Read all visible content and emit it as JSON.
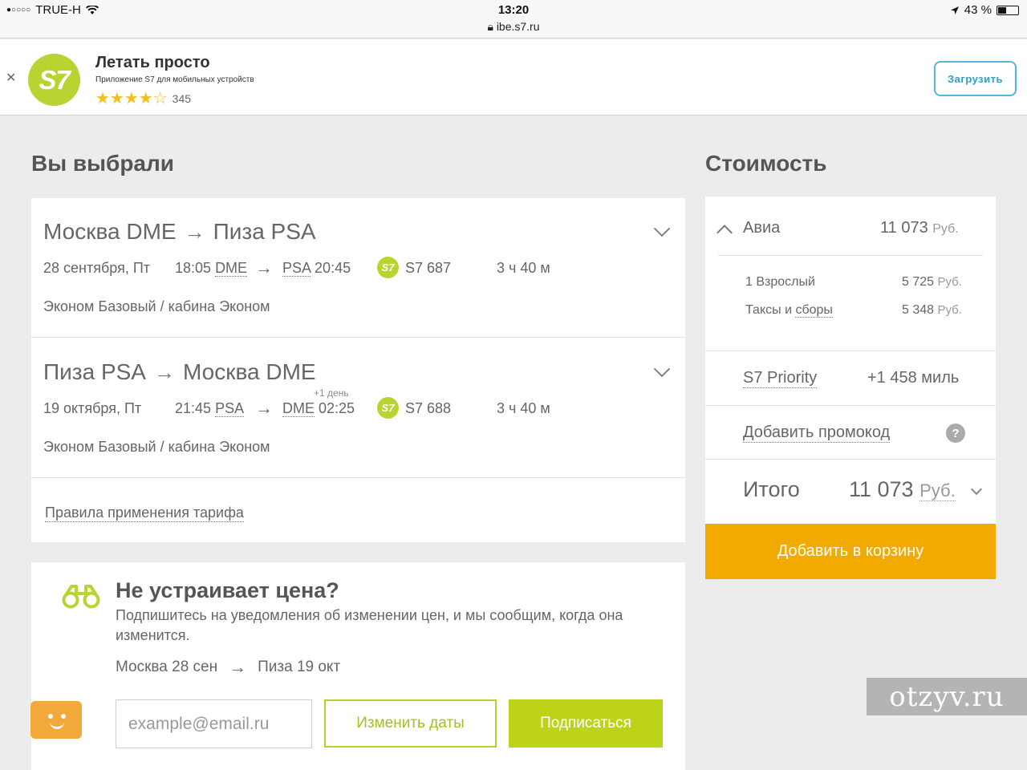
{
  "status_bar": {
    "carrier": "TRUE-H",
    "time": "13:20",
    "url": "ibe.s7.ru",
    "battery": "43 %",
    "battery_level": 0.43
  },
  "app_banner": {
    "logo_text": "S7",
    "title": "Летать просто",
    "subtitle": "Приложение S7 для мобильных устройств",
    "rating_stars": 4.5,
    "rating_count": "345",
    "download_label": "Загрузить"
  },
  "selected": {
    "heading": "Вы выбрали",
    "legs": [
      {
        "from": "Москва DME",
        "to": "Пиза PSA",
        "date": "28 сентября, Пт",
        "dep_time": "18:05",
        "dep_code": "DME",
        "arr_code": "PSA",
        "arr_time": "20:45",
        "plus_day": "",
        "airline_badge": "S7",
        "flight": "S7 687",
        "duration": "3 ч 40 м",
        "fare": "Эконом Базовый / кабина Эконом"
      },
      {
        "from": "Пиза PSA",
        "to": "Москва DME",
        "date": "19 октября, Пт",
        "dep_time": "21:45",
        "dep_code": "PSA",
        "arr_code": "DME",
        "arr_time": "02:25",
        "plus_day": "+1 день",
        "airline_badge": "S7",
        "flight": "S7 688",
        "duration": "3 ч 40 м",
        "fare": "Эконом Базовый / кабина Эконом"
      }
    ],
    "rules_link": "Правила применения тарифа"
  },
  "subscription": {
    "title": "Не устраивает цена?",
    "text": "Подпишитесь на уведомления об изменении цен, и мы сообщим, когда она изменится.",
    "route_from": "Москва 28 сен",
    "route_to": "Пиза 19 окт",
    "email_placeholder": "example@email.ru",
    "change_dates": "Изменить даты",
    "subscribe": "Подписаться"
  },
  "cost": {
    "heading": "Стоимость",
    "avia_label": "Авиа",
    "avia_value": "11 073",
    "currency": "Руб.",
    "adult_label": "1 Взрослый",
    "adult_value": "5 725",
    "taxes_prefix": "Таксы и ",
    "taxes_link": "сборы",
    "taxes_value": "5 348",
    "priority_label": "S7 Priority",
    "priority_value": "+1 458 миль",
    "promo_label": "Добавить промокод",
    "help": "?",
    "total_label": "Итого",
    "total_value": "11 073",
    "add_to_cart": "Добавить в корзину"
  },
  "watermark": "otzyv.ru",
  "colors": {
    "s7_green": "#b8d432",
    "cart_orange": "#f2a900",
    "banner_blue": "#53b7dd",
    "chat_orange": "#f3a83a"
  }
}
